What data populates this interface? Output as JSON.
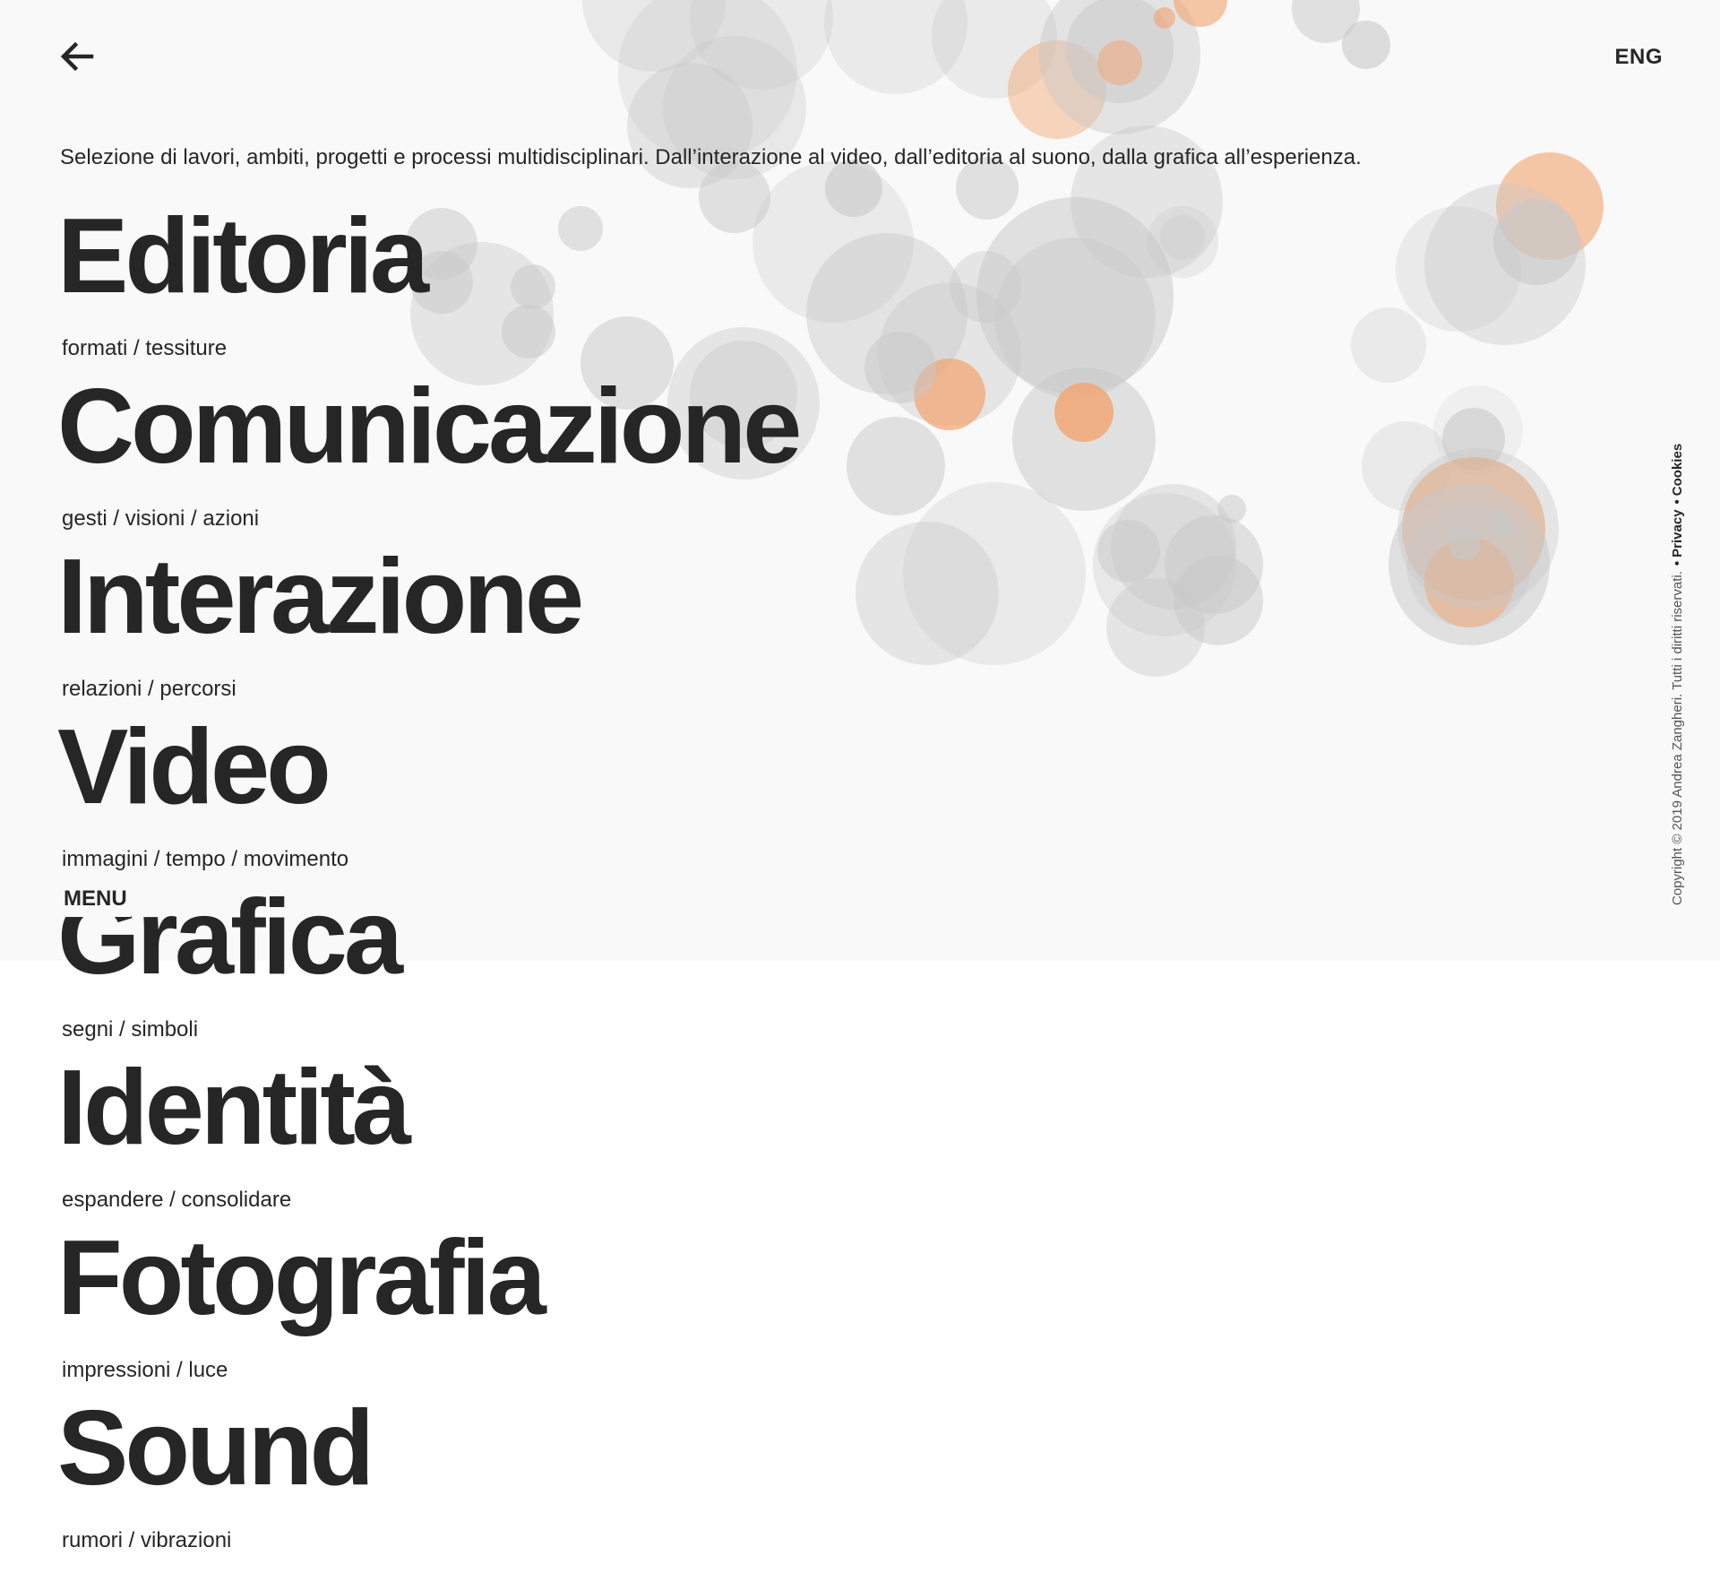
{
  "header": {
    "back_icon": "arrow-left-icon",
    "lang_label": "ENG"
  },
  "intro": "Selezione di lavori, ambiti, progetti e processi multidisciplinari. Dall’interazione al video, dall’editoria al suono,  dalla grafica all’esperienza.",
  "categories": [
    {
      "title": "Editoria",
      "sub": "formati / tessiture"
    },
    {
      "title": "Comunicazione",
      "sub": "gesti / visioni / azioni"
    },
    {
      "title": "Interazione",
      "sub": "relazioni / percorsi"
    },
    {
      "title": "Video",
      "sub": "immagini / tempo / movimento"
    },
    {
      "title": "Grafica",
      "sub": "segni / simboli"
    },
    {
      "title": "Identità",
      "sub": "espandere / consolidare"
    },
    {
      "title": "Fotografia",
      "sub": "impressioni / luce"
    },
    {
      "title": "Sound",
      "sub": "rumori / vibrazioni"
    }
  ],
  "menu_label": "MENU",
  "footer": {
    "copyright": "Copyright © 2019 Andrea Zangheri. Tutti i diritti riservati.",
    "privacy": "Privacy",
    "cookies": "Cookies"
  },
  "colors": {
    "text": "#262626",
    "panel": "#f9f9f9",
    "accent": "#f2a46e",
    "bubble": "#c8c8c8"
  }
}
